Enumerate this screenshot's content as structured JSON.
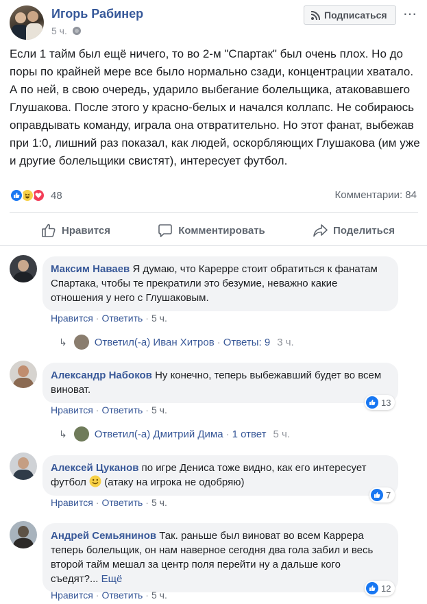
{
  "post": {
    "author": "Игорь Рабинер",
    "time": "5 ч.",
    "subscribe_label": "Подписаться",
    "text": "Если 1 тайм был ещё ничего, то во 2-м \"Спартак\" был очень плох. Но до поры по крайней мере все было нормально сзади, концентрации хватало. А по ней, в свою очередь, ударило выбегание болельщика, атаковавшего Глушакова. После этого у красно-белых и начался коллапс. Не собираюсь оправдывать команду, играла она отвратительно. Но этот фанат, выбежав при 1:0, лишний раз показал, как людей, оскорбляющих Глушакова (им уже и другие болельщики свистят), интересует футбол.",
    "reactions_count": "48",
    "comments_count_label": "Комментарии: 84",
    "reaction_icons": [
      "like-icon",
      "haha-icon",
      "love-icon"
    ]
  },
  "actions": {
    "like": "Нравится",
    "comment": "Комментировать",
    "share": "Поделиться"
  },
  "comments": [
    {
      "name": "Максим Наваев",
      "text": "Я думаю, что Карерре стоит обратиться к фанатам Спартака, чтобы те прекратили это безумие, неважно какие отношения у него с Глушаковым.",
      "like": "Нравится",
      "reply": "Ответить",
      "time": "5 ч.",
      "replies": {
        "label": "Ответил(-а) Иван Хитров",
        "count": "Ответы: 9",
        "time": "3 ч."
      }
    },
    {
      "name": "Александр Набоков",
      "text": "Ну конечно, теперь выбежавший будет во всем виноват.",
      "like": "Нравится",
      "reply": "Ответить",
      "time": "5 ч.",
      "likes": "13",
      "replies": {
        "label": "Ответил(-а) Дмитрий Дима",
        "count": "1 ответ",
        "time": "5 ч."
      }
    },
    {
      "name": "Алексей Цуканов",
      "text_before": "по игре Дениса тоже видно, как его интересует футбол",
      "text_after": "(атаку на игрока не одобряю)",
      "like": "Нравится",
      "reply": "Ответить",
      "time": "5 ч.",
      "likes": "7"
    },
    {
      "name": "Андрей Семьянинов",
      "text": "Так. раньше был виноват во всем Каррера теперь болельщик, он нам наверное сегодня два гола забил и весь второй тайм мешал за центр поля перейти ну а дальше кого съедят?...",
      "more": "Ещё",
      "like": "Нравится",
      "reply": "Ответить",
      "time": "5 ч.",
      "likes": "12"
    }
  ],
  "separators": {
    "dot": "·"
  },
  "colors": {
    "link": "#385898",
    "accent": "#1877f2",
    "muted": "#606770",
    "bubble": "#f2f3f5"
  }
}
